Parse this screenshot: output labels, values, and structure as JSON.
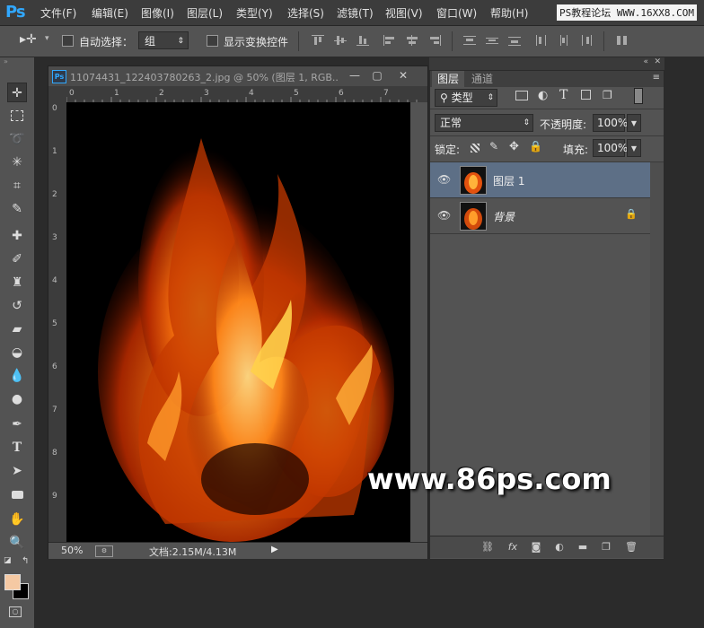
{
  "menubar": {
    "logo": "Ps",
    "items": [
      "文件(F)",
      "编辑(E)",
      "图像(I)",
      "图层(L)",
      "类型(Y)",
      "选择(S)",
      "滤镜(T)",
      "视图(V)",
      "窗口(W)",
      "帮助(H)"
    ],
    "watermark": "PS教程论坛 WWW.16XX8.COM"
  },
  "options": {
    "auto_select_label": "自动选择：",
    "auto_select_value": "组",
    "show_transform_label": "显示变换控件"
  },
  "document": {
    "title": "11074431_122403780263_2.jpg @ 50% (图层 1, RGB...",
    "win_minimize": "—",
    "win_restore": "▢",
    "win_close": "✕",
    "ruler_top": [
      "0",
      "1",
      "2",
      "3",
      "4",
      "5",
      "6",
      "7"
    ],
    "ruler_left": [
      "0",
      "1",
      "2",
      "3",
      "4",
      "5",
      "6",
      "7",
      "8",
      "9"
    ],
    "zoom": "50%",
    "doc_size": "文档:2.15M/4.13M"
  },
  "layers_panel": {
    "tab_layers": "图层",
    "tab_channels": "通道",
    "filter_type": "类型",
    "blend_mode": "正常",
    "opacity_label": "不透明度:",
    "opacity_value": "100%",
    "lock_label": "锁定:",
    "fill_label": "填充:",
    "fill_value": "100%",
    "layers": [
      {
        "name": "图层 1",
        "selected": true
      },
      {
        "name": "背景",
        "selected": false,
        "locked": true
      }
    ]
  },
  "watermark": "www.86ps.com",
  "colors": {
    "foreground": "#f5c9a3",
    "background": "#000000",
    "selection": "#5d6f86",
    "accent": "#31a8ff"
  }
}
